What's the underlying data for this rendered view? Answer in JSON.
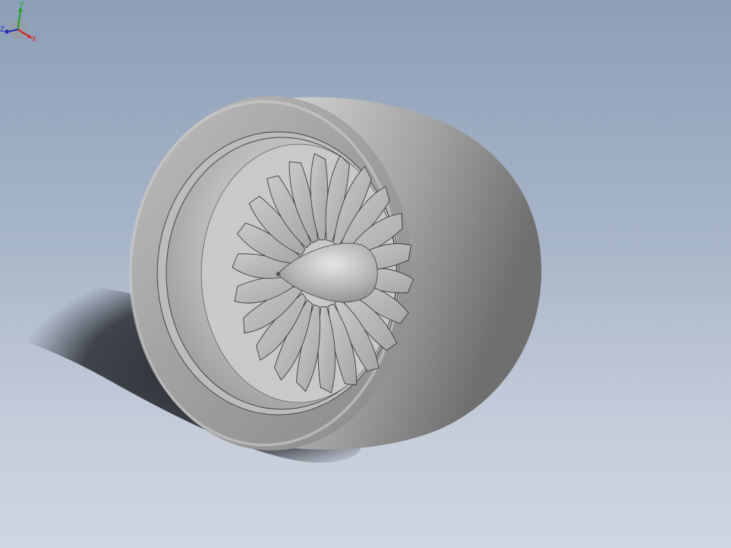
{
  "viewport": {
    "background_top": "#8c9fb7",
    "background_bottom": "#cfd6e1",
    "model_color": "#c4c4c4",
    "model": {
      "name": "turbofan-engine-nacelle",
      "blade_count": 22
    }
  },
  "triad": {
    "x_label": "X",
    "y_label": "Y",
    "z_label": "Z",
    "x_color": "#d42020",
    "y_color": "#1ea51e",
    "z_color": "#1f2fb0"
  }
}
